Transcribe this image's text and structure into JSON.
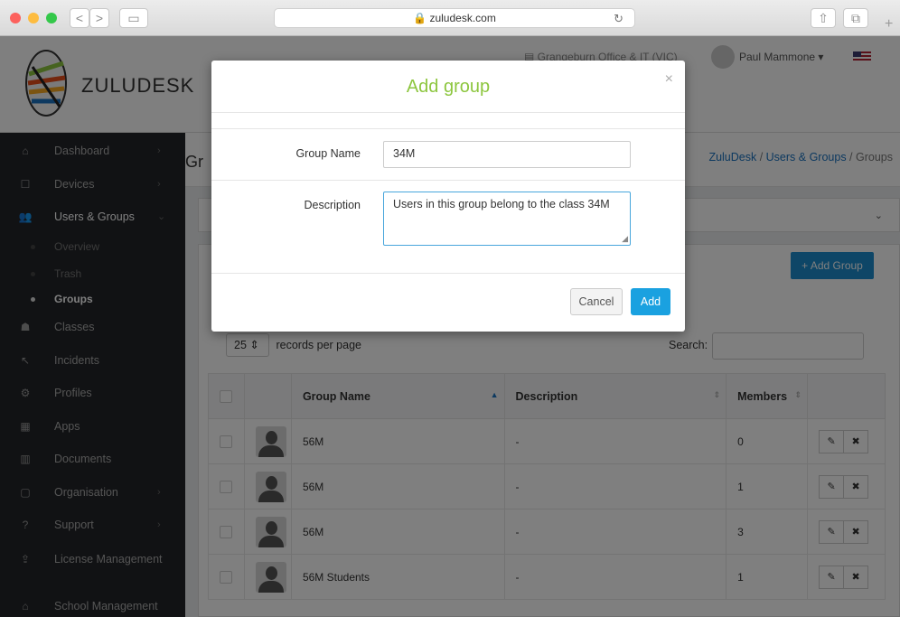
{
  "browser": {
    "url": "zuludesk.com",
    "nav_back": "<",
    "nav_forward": ">",
    "colors": {
      "close": "#fc615d",
      "min": "#fdbc40",
      "max": "#34c84a"
    }
  },
  "header": {
    "logo_text": "ZULUDESK",
    "office": "Grangeburn Office & IT (VIC)",
    "user_name": "Paul Mammone",
    "user_caret": "▾"
  },
  "sidebar": {
    "items": [
      {
        "icon": "⌂",
        "label": "Dashboard",
        "chev": "›"
      },
      {
        "icon": "☐",
        "label": "Devices",
        "chev": "›"
      },
      {
        "icon": "👥",
        "label": "Users & Groups",
        "chev": "⌄"
      },
      {
        "icon": "☗",
        "label": "Classes",
        "chev": ""
      },
      {
        "icon": "↖",
        "label": "Incidents",
        "chev": ""
      },
      {
        "icon": "⚙",
        "label": "Profiles",
        "chev": ""
      },
      {
        "icon": "▦",
        "label": "Apps",
        "chev": ""
      },
      {
        "icon": "▥",
        "label": "Documents",
        "chev": ""
      },
      {
        "icon": "▢",
        "label": "Organisation",
        "chev": "›"
      },
      {
        "icon": "?",
        "label": "Support",
        "chev": "›"
      },
      {
        "icon": "⇪",
        "label": "License Management",
        "chev": ""
      },
      {
        "icon": "⌂",
        "label": "School Management",
        "chev": ""
      }
    ],
    "subitems": [
      "Overview",
      "Trash",
      "Groups"
    ]
  },
  "page": {
    "title": "Gr",
    "breadcrumb": [
      "ZuluDesk",
      "Users & Groups",
      "Groups"
    ],
    "add_group_label": "+ Add Group",
    "records_value": "25",
    "records_label": "records per page",
    "search_label": "Search:"
  },
  "table": {
    "columns": [
      "Group Name",
      "Description",
      "Members"
    ],
    "rows": [
      {
        "name": "56M",
        "description": "-",
        "members": "0"
      },
      {
        "name": "56M",
        "description": "-",
        "members": "1"
      },
      {
        "name": "56M",
        "description": "-",
        "members": "3"
      },
      {
        "name": "56M Students",
        "description": "-",
        "members": "1"
      }
    ],
    "edit_icon": "✎",
    "delete_icon": "✖"
  },
  "modal": {
    "title": "Add group",
    "close": "×",
    "name_label": "Group Name",
    "name_value": "34M",
    "desc_label": "Description",
    "desc_value": "Users in this group belong to the class 34M",
    "cancel_label": "Cancel",
    "add_label": "Add",
    "colors": {
      "title": "#8dc63f",
      "add_button": "#1aa1e0"
    }
  }
}
